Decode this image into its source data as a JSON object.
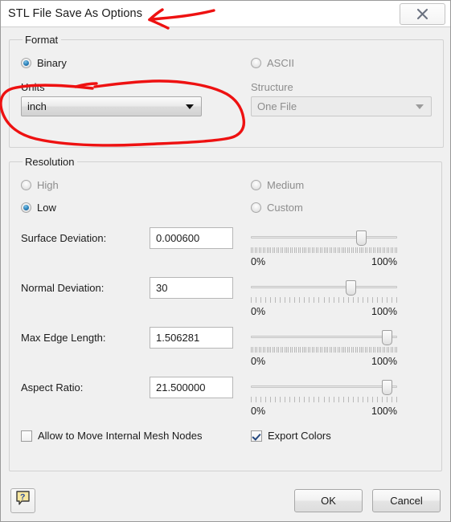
{
  "window": {
    "title": "STL File Save As Options",
    "close_icon": "close-x-icon"
  },
  "format": {
    "legend": "Format",
    "binary": {
      "label": "Binary",
      "selected": true
    },
    "ascii": {
      "label": "ASCII",
      "selected": false
    },
    "units": {
      "label": "Units",
      "value": "inch",
      "enabled": true
    },
    "structure": {
      "label": "Structure",
      "value": "One File",
      "enabled": false
    }
  },
  "resolution": {
    "legend": "Resolution",
    "high": {
      "label": "High",
      "selected": false
    },
    "medium": {
      "label": "Medium",
      "selected": false
    },
    "low": {
      "label": "Low",
      "selected": true
    },
    "custom": {
      "label": "Custom",
      "selected": false
    },
    "min_label": "0%",
    "max_label": "100%",
    "fields": [
      {
        "label": "Surface Deviation:",
        "value": "0.000600",
        "slider_pct": 75
      },
      {
        "label": "Normal Deviation:",
        "value": "30",
        "slider_pct": 68
      },
      {
        "label": "Max Edge Length:",
        "value": "1.506281",
        "slider_pct": 93
      },
      {
        "label": "Aspect Ratio:",
        "value": "21.500000",
        "slider_pct": 93
      }
    ],
    "allow_move_nodes": {
      "label": "Allow to Move Internal Mesh Nodes",
      "checked": false
    },
    "export_colors": {
      "label": "Export Colors",
      "checked": true
    }
  },
  "footer": {
    "help_icon": "help-question-icon",
    "ok_label": "OK",
    "cancel_label": "Cancel"
  },
  "annotations": {
    "accent_color": "#ee1111",
    "arrow_to_title": "hand-drawn-arrow",
    "circle_around_units": "hand-drawn-ellipse"
  }
}
